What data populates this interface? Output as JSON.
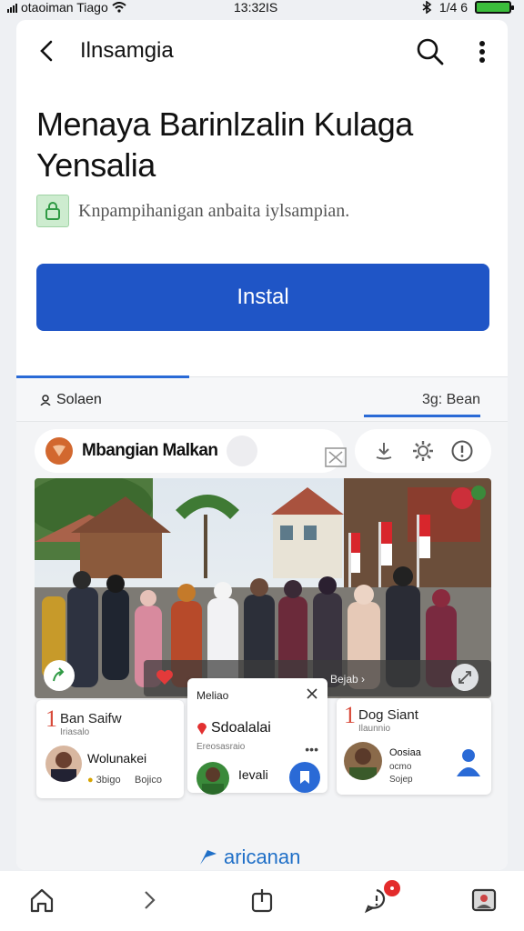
{
  "status_bar": {
    "carrier": "otaoiman Tiago",
    "time": "13:32IS",
    "indicator_text": "1/4 6"
  },
  "app_bar": {
    "title": "Ilnsamgia"
  },
  "headline": "Menaya Barinlzalin Kulaga Yensalia",
  "badge": {
    "text": "Knpampihanigan anbaita iylsampian."
  },
  "install_button": {
    "label": "Instal"
  },
  "tabs": {
    "left_label": "Solaen",
    "right_label": "3g: Bean"
  },
  "post": {
    "title": "Mbangian Malkan",
    "photo_bar_text": "Bejab"
  },
  "cards": [
    {
      "num": "1",
      "name": "Ban Saifw",
      "sub": "Iriasalo",
      "person": "Wolunakei",
      "meta1": "3bigo",
      "meta2": "Bojico"
    },
    {
      "head": "Meliao",
      "name": "Sdoalalai",
      "sub": "Ereosasraio",
      "person": "Ievali"
    },
    {
      "num": "1",
      "name": "Dog Siant",
      "sub": "Ilaunnio",
      "person": "Oosiaa",
      "meta1": "ocmo",
      "meta2": "Sojep"
    }
  ],
  "more_link": "aricanan",
  "colors": {
    "primary": "#1f55c6",
    "accent_red": "#d84a3a",
    "link": "#1f6fc7",
    "badge_green": "#cdeccf"
  }
}
